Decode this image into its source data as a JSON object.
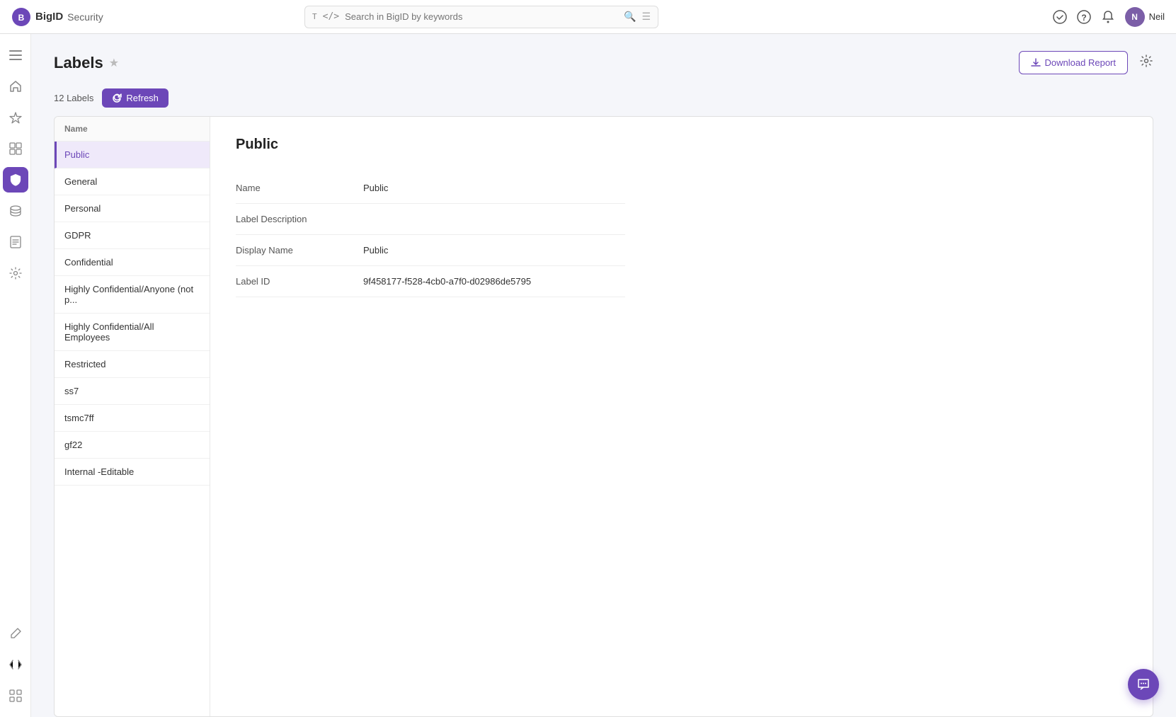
{
  "app": {
    "name": "BigID",
    "product": "Security"
  },
  "navbar": {
    "search_placeholder": "Search in BigID by keywords",
    "user_name": "Neil",
    "user_initial": "N"
  },
  "page": {
    "title": "Labels",
    "labels_count": "12 Labels",
    "download_btn": "Download Report",
    "refresh_btn": "Refresh"
  },
  "labels_list": {
    "header": "Name",
    "items": [
      {
        "id": 1,
        "name": "Public",
        "active": true
      },
      {
        "id": 2,
        "name": "General",
        "active": false
      },
      {
        "id": 3,
        "name": "Personal",
        "active": false
      },
      {
        "id": 4,
        "name": "GDPR",
        "active": false
      },
      {
        "id": 5,
        "name": "Confidential",
        "active": false
      },
      {
        "id": 6,
        "name": "Highly Confidential/Anyone (not p...",
        "active": false
      },
      {
        "id": 7,
        "name": "Highly Confidential/All Employees",
        "active": false
      },
      {
        "id": 8,
        "name": "Restricted",
        "active": false
      },
      {
        "id": 9,
        "name": "ss7",
        "active": false
      },
      {
        "id": 10,
        "name": "tsmc7ff",
        "active": false
      },
      {
        "id": 11,
        "name": "gf22",
        "active": false
      },
      {
        "id": 12,
        "name": "Internal -Editable",
        "active": false
      }
    ]
  },
  "detail": {
    "title": "Public",
    "rows": [
      {
        "label": "Name",
        "value": "Public"
      },
      {
        "label": "Label Description",
        "value": ""
      },
      {
        "label": "Display Name",
        "value": "Public"
      },
      {
        "label": "Label ID",
        "value": "9f458177-f528-4cb0-a7f0-d02986de5795"
      }
    ]
  },
  "icons": {
    "menu": "⋮⋮⋮",
    "home": "⌂",
    "star": "☆",
    "bell": "🔔",
    "search": "🔍",
    "settings": "⚙",
    "download": "↓",
    "refresh": "↻",
    "shield": "🛡",
    "chart": "📊",
    "database": "🗄",
    "tag": "🏷",
    "grid": "⊞",
    "help": "?"
  },
  "sidebar": {
    "items": [
      {
        "icon": "home",
        "label": "Home",
        "active": false
      },
      {
        "icon": "star",
        "label": "Favorites",
        "active": false
      },
      {
        "icon": "chart",
        "label": "Dashboard",
        "active": false
      },
      {
        "icon": "database",
        "label": "Data",
        "active": false
      },
      {
        "icon": "shield",
        "label": "Security",
        "active": true
      },
      {
        "icon": "tag",
        "label": "Labels",
        "active": false
      },
      {
        "icon": "grid",
        "label": "More",
        "active": false
      }
    ]
  }
}
